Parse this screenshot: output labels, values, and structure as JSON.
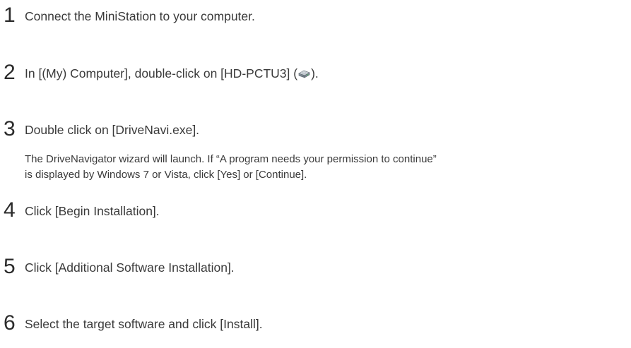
{
  "steps": [
    {
      "number": "1",
      "text": "Connect the MiniStation to your computer."
    },
    {
      "number": "2",
      "text_before": "In [(My) Computer], double-click on [HD-PCTU3] (",
      "icon": "drive-icon",
      "text_after": ")."
    },
    {
      "number": "3",
      "text": "Double click on [DriveNavi.exe].",
      "note_line1": "The DriveNavigator wizard will launch.  If “A program needs your permission to continue”",
      "note_line2": "is displayed by Windows 7 or Vista, click [Yes] or [Continue]."
    },
    {
      "number": "4",
      "text": "Click [Begin Installation]."
    },
    {
      "number": "5",
      "text": "Click [Additional Software Installation]."
    },
    {
      "number": "6",
      "text": "Select the target software and click [Install]."
    }
  ]
}
